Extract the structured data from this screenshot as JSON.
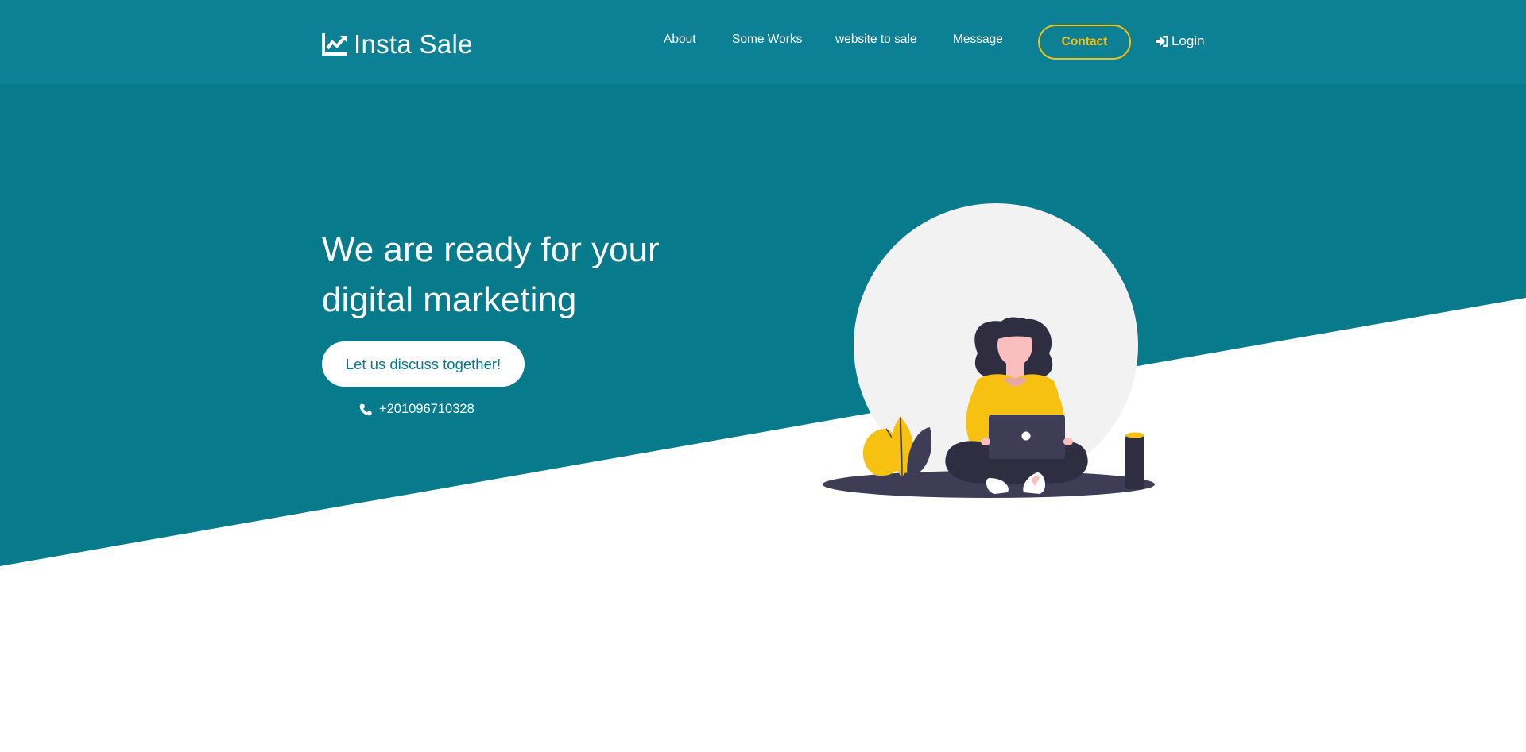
{
  "brand": {
    "name": "Insta Sale",
    "icon": "chart-line-icon"
  },
  "nav": {
    "links": [
      {
        "label": "About"
      },
      {
        "label": "Some Works"
      },
      {
        "label": "website to sale"
      },
      {
        "label": "Message"
      }
    ],
    "contact_label": "Contact",
    "login_label": "Login",
    "login_icon": "sign-in-icon"
  },
  "hero": {
    "headline_line1": "We are ready for your",
    "headline_line2": "digital marketing",
    "cta_label": "Let us discuss together!",
    "phone_icon": "phone-icon",
    "phone_number": "+201096710328",
    "illustration": "woman-with-laptop-illustration"
  },
  "colors": {
    "navbar": "#0c8196",
    "hero": "#077a8b",
    "accent": "#f6c111",
    "white": "#ffffff",
    "illustration_circle": "#f2f2f2",
    "illustration_dark": "#3f3d56"
  }
}
